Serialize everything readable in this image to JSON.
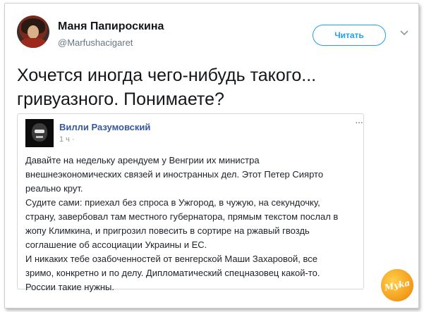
{
  "tweet": {
    "author_name": "Маня Папироскина",
    "author_handle": "@Marfushacigaret",
    "follow_label": "Читать",
    "text_lines": [
      "Хочется иногда чего-нибудь такого...",
      "гривуазного. Понимаете?"
    ]
  },
  "embedded_post": {
    "author_name": "Вилли Разумовский",
    "meta": "1 ч ·",
    "menu": "···",
    "lines": [
      "Давайте на недельку арендуем у Венгрии их министра",
      "внешнеэкономических связей и иностранных дел. Этот Петер Сиярто",
      "реально крут.",
      "Судите сами: приехал без спроса в Ужгород, в чужую, на секундочку,",
      "страну, завербовал там местного губернатора, прямым текстом послал в",
      "жопу Климкина, и пригрозил повесить в сортире на ржавый гвоздь",
      "соглашение об ассоциации Украины и ЕС.",
      "И никаких тебе озабоченностей от венгерской Маши Захаровой, все",
      "зримо, конкретно и по делу. Дипломатический спецназовец какой-то.",
      "России такие нужны."
    ]
  },
  "watermark": {
    "text": "Myka"
  },
  "colors": {
    "twitter_blue": "#1da1f2",
    "fb_link_blue": "#365899",
    "watermark_orange": "#f29a1a"
  }
}
